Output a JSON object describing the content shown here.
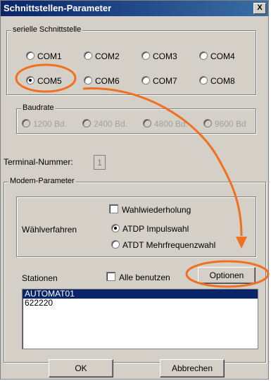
{
  "window": {
    "title": "Schnittstellen-Parameter",
    "close_label": "X"
  },
  "serial": {
    "group_label": "serielle Schnittstelle",
    "ports": [
      "COM1",
      "COM2",
      "COM3",
      "COM4",
      "COM5",
      "COM6",
      "COM7",
      "COM8"
    ],
    "selected": "COM5"
  },
  "baud": {
    "group_label": "Baudrate",
    "options": [
      "1200 Bd.",
      "2400 Bd.",
      "4800 Bd.",
      "9600 Bd"
    ]
  },
  "terminal": {
    "label": "Terminal-Nummer:",
    "value": "1"
  },
  "modem": {
    "group_label": "Modem-Parameter",
    "redial_label": "Wahlwiederholung",
    "dial_method_label": "Wählverfahren",
    "pulse_label": "ATDP Impulswahl",
    "tone_label": "ATDT Mehrfrequenzwahl",
    "dial_selected": "ATDP Impulswahl",
    "stations_label": "Stationen",
    "use_all_label": "Alle benutzen",
    "options_button": "Optionen",
    "stations": [
      "AUTOMAT01",
      "622220"
    ],
    "selected_station": "AUTOMAT01"
  },
  "footer": {
    "ok_label": "OK",
    "cancel_label": "Abbrechen"
  },
  "annotation": {
    "color": "#f07020"
  }
}
